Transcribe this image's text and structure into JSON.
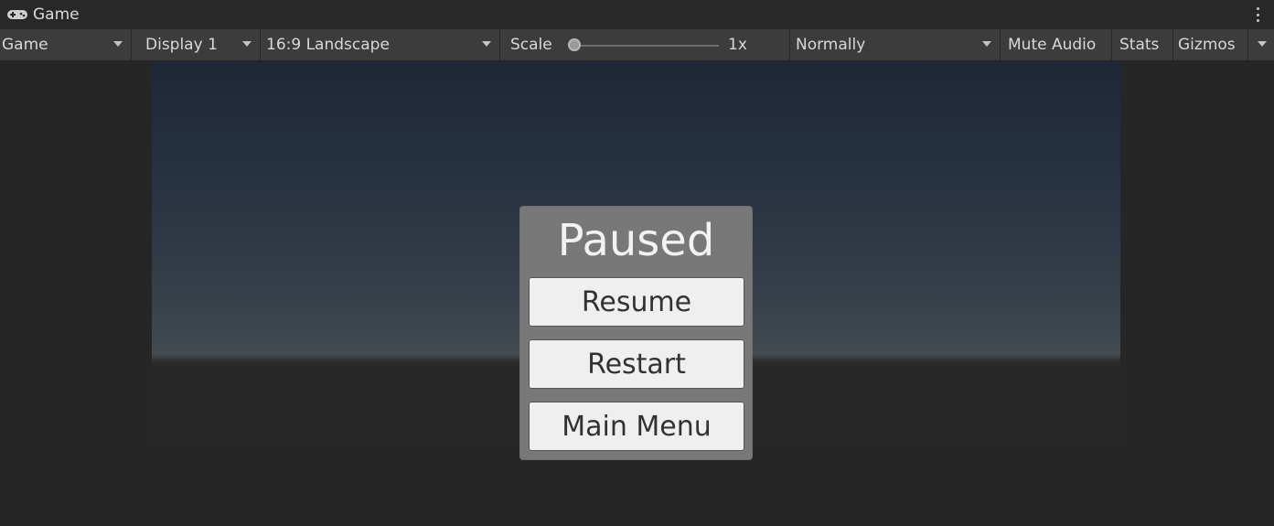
{
  "window": {
    "tab_label": "Game",
    "tab_icon": "gamepad-icon"
  },
  "toolbar": {
    "mode": "Game",
    "display": "Display 1",
    "aspect": "16:9 Landscape",
    "scale_label": "Scale",
    "scale_value": "1x",
    "play_mode": "Normally",
    "mute_audio": "Mute Audio",
    "stats": "Stats",
    "gizmos": "Gizmos"
  },
  "pause_menu": {
    "title": "Paused",
    "buttons": [
      "Resume",
      "Restart",
      "Main Menu"
    ]
  },
  "colors": {
    "panel": "#787878",
    "button": "#efefef",
    "toolbar": "#3c3c3c",
    "sky_top": "#1f2737",
    "horizon": "#454c51",
    "ground": "#262626"
  }
}
